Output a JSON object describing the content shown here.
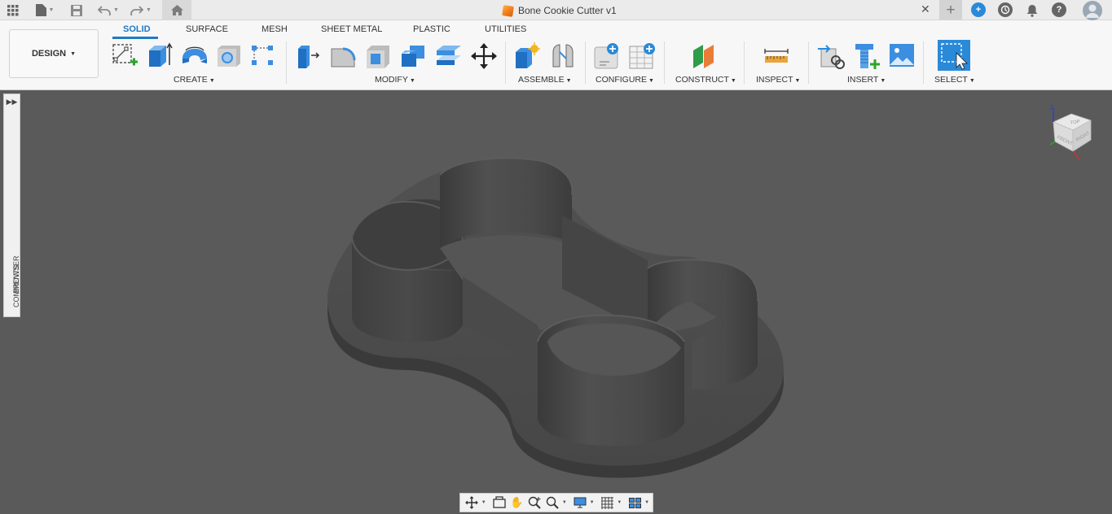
{
  "app": {
    "document_title": "Bone Cookie Cutter v1",
    "title_icons": [
      "app-grid-icon",
      "file-icon",
      "save-icon",
      "undo-icon",
      "redo-icon",
      "home-icon"
    ],
    "right_icons": [
      "new-tab-icon",
      "extensions-icon",
      "job-status-icon",
      "notifications-icon",
      "help-icon",
      "user-avatar"
    ]
  },
  "toolbar": {
    "workspace_button": "DESIGN",
    "tabs": [
      {
        "label": "SOLID",
        "active": true
      },
      {
        "label": "SURFACE",
        "active": false
      },
      {
        "label": "MESH",
        "active": false
      },
      {
        "label": "SHEET METAL",
        "active": false
      },
      {
        "label": "PLASTIC",
        "active": false
      },
      {
        "label": "UTILITIES",
        "active": false
      }
    ],
    "groups": [
      {
        "label": "CREATE",
        "icons": [
          "create-sketch-icon",
          "extrude-icon",
          "revolve-icon",
          "hole-icon",
          "pattern-icon"
        ]
      },
      {
        "label": "MODIFY",
        "icons": [
          "press-pull-icon",
          "fillet-icon",
          "shell-icon",
          "combine-icon",
          "offset-face-icon",
          "move-icon"
        ]
      },
      {
        "label": "ASSEMBLE",
        "icons": [
          "new-component-icon",
          "joint-icon"
        ]
      },
      {
        "label": "CONFIGURE",
        "icons": [
          "configure-icon",
          "configuration-table-icon"
        ]
      },
      {
        "label": "CONSTRUCT",
        "icons": [
          "offset-plane-icon"
        ]
      },
      {
        "label": "INSPECT",
        "icons": [
          "measure-icon"
        ]
      },
      {
        "label": "INSERT",
        "icons": [
          "insert-derive-icon",
          "insert-mcmaster-icon",
          "insert-canvas-icon"
        ]
      },
      {
        "label": "SELECT",
        "icons": [
          "select-icon"
        ]
      }
    ]
  },
  "sidebar": {
    "browser_label": "BROWSER",
    "comments_label": "COMMENTS",
    "expand_icon": "double-chevron-right-icon"
  },
  "viewcube": {
    "top": "TOP",
    "front": "FRONT",
    "right": "RIGHT",
    "axis_z": "Z"
  },
  "navbar": {
    "icons": [
      "orbit-icon",
      "look-at-icon",
      "pan-icon",
      "zoom-icon",
      "fit-icon",
      "display-settings-icon",
      "grid-snaps-icon",
      "viewports-icon"
    ]
  },
  "colors": {
    "accent": "#1f7ac7",
    "viewport_background": "#5a5a5a",
    "model_body": "#4f4f4f"
  }
}
